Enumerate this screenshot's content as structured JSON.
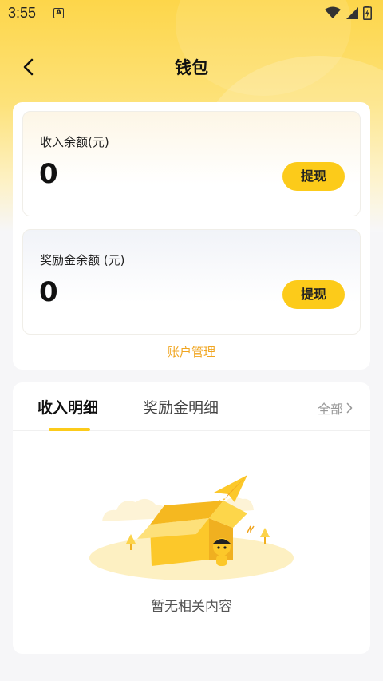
{
  "status_bar": {
    "time": "3:55",
    "notification_badge": "A",
    "icons": [
      "wifi-icon",
      "signal-icon",
      "battery-icon"
    ]
  },
  "header": {
    "title": "钱包",
    "back_icon": "chevron-left-icon"
  },
  "wallet": {
    "income": {
      "label": "收入余额(元)",
      "amount": "0",
      "button_label": "提现"
    },
    "reward": {
      "label": "奖励金余额 (元)",
      "amount": "0",
      "button_label": "提现"
    },
    "account_manage_label": "账户管理"
  },
  "details": {
    "tabs": [
      {
        "label": "收入明细",
        "active": true
      },
      {
        "label": "奖励金明细",
        "active": false
      }
    ],
    "all_label": "全部",
    "empty_text": "暂无相关内容",
    "empty_illustration": "empty-box-illustration"
  },
  "colors": {
    "accent": "#fccb1a",
    "link": "#f0a520",
    "header_gradient_top": "#fdd64a"
  }
}
